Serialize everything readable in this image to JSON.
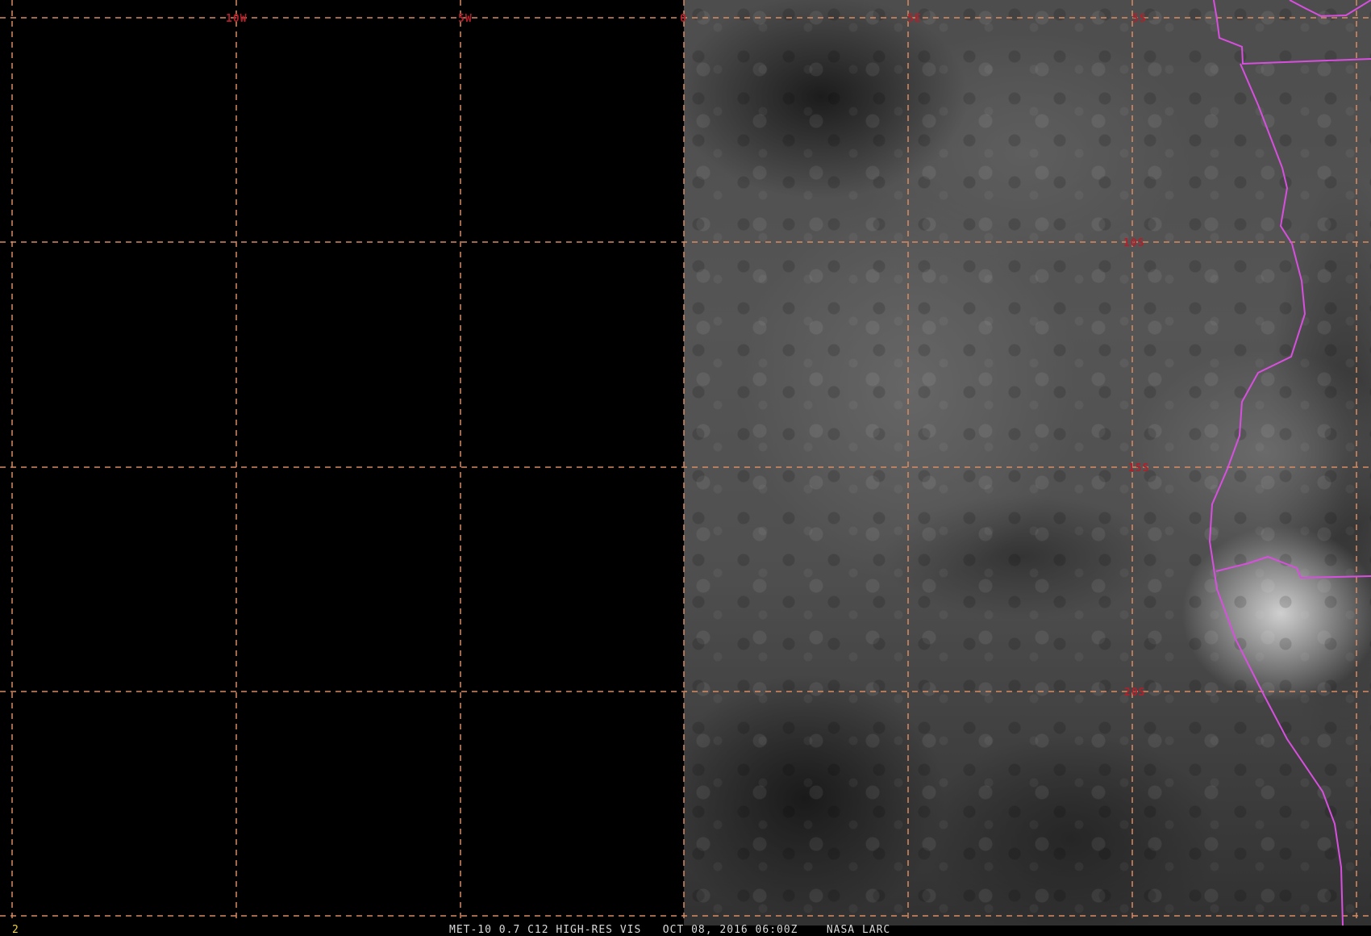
{
  "map": {
    "longitude_labels": [
      "10W",
      "5W",
      "0",
      "5E",
      "5S"
    ],
    "latitude_labels": [
      "10S",
      "15S",
      "20S"
    ],
    "colors": {
      "background": "#000000",
      "grid": "#d88b62",
      "label": "#b21f2a",
      "border": "#d84fe0",
      "footer_text": "#d9d9d9",
      "footer_number": "#f2d34a"
    }
  },
  "footer": {
    "left_number": "2",
    "caption": "MET-10 0.7 C12 HIGH-RES VIS   OCT 08, 2016 06:00Z    NASA LARC"
  }
}
